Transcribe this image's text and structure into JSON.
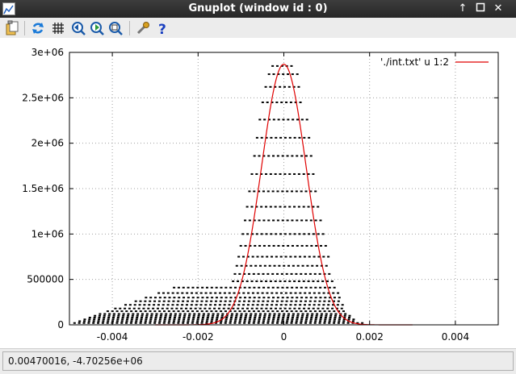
{
  "window": {
    "title": "Gnuplot (window id : 0)",
    "titlebar_buttons": [
      "up-arrow",
      "maximize",
      "close"
    ],
    "toolbar_icons": [
      "copy-to-clipboard-icon",
      "replot-icon",
      "grid-icon",
      "zoom-previous-icon",
      "zoom-next-icon",
      "autoscale-icon",
      "settings-icon",
      "help-icon"
    ]
  },
  "status": {
    "coordinates": "0.00470016, -4.70256e+06"
  },
  "chart_data": {
    "type": "scatter",
    "title": "",
    "xlabel": "",
    "ylabel": "",
    "xlim": [
      -0.005,
      0.005
    ],
    "ylim": [
      0,
      3000000
    ],
    "xticks": [
      {
        "value": -0.004,
        "label": "-0.004"
      },
      {
        "value": -0.002,
        "label": "-0.002"
      },
      {
        "value": 0,
        "label": "0"
      },
      {
        "value": 0.002,
        "label": "0.002"
      },
      {
        "value": 0.004,
        "label": "0.004"
      }
    ],
    "yticks": [
      {
        "value": 0,
        "label": "0"
      },
      {
        "value": 500000,
        "label": "500000"
      },
      {
        "value": 1000000,
        "label": "1e+06"
      },
      {
        "value": 1500000,
        "label": "1.5e+06"
      },
      {
        "value": 2000000,
        "label": "2e+06"
      },
      {
        "value": 2500000,
        "label": "2.5e+06"
      },
      {
        "value": 3000000,
        "label": "3e+06"
      }
    ],
    "grid": true,
    "legend_position": "top-right",
    "series": [
      {
        "name": "'./int.txt' u 1:2",
        "kind": "line",
        "color": "#e00000",
        "x": [
          -0.003,
          -0.0025,
          -0.002,
          -0.0018,
          -0.0016,
          -0.0014,
          -0.0012,
          -0.001,
          -0.0008,
          -0.0006,
          -0.0004,
          -0.0002,
          0,
          0.0002,
          0.0004,
          0.0006,
          0.0008,
          0.001,
          0.0012,
          0.0014,
          0.0016,
          0.0018,
          0.002,
          0.0025,
          0.003
        ],
        "y": [
          0,
          0,
          0,
          10000,
          60000,
          180000,
          420000,
          800000,
          1300000,
          1850000,
          2350000,
          2720000,
          2870000,
          2720000,
          2350000,
          1850000,
          1300000,
          800000,
          420000,
          180000,
          60000,
          10000,
          0,
          0,
          0
        ]
      },
      {
        "name": "",
        "kind": "points",
        "color": "#000000",
        "description_levels": [
          20000,
          40000,
          60000,
          80000,
          100000,
          120000,
          150000,
          180000,
          220000,
          260000,
          300000,
          350000,
          410000,
          480000,
          560000,
          650000,
          750000,
          870000,
          1000000,
          1150000,
          1300000,
          1470000,
          1660000,
          1860000,
          2060000,
          2260000,
          2450000,
          2620000,
          2760000,
          2850000
        ]
      }
    ]
  }
}
